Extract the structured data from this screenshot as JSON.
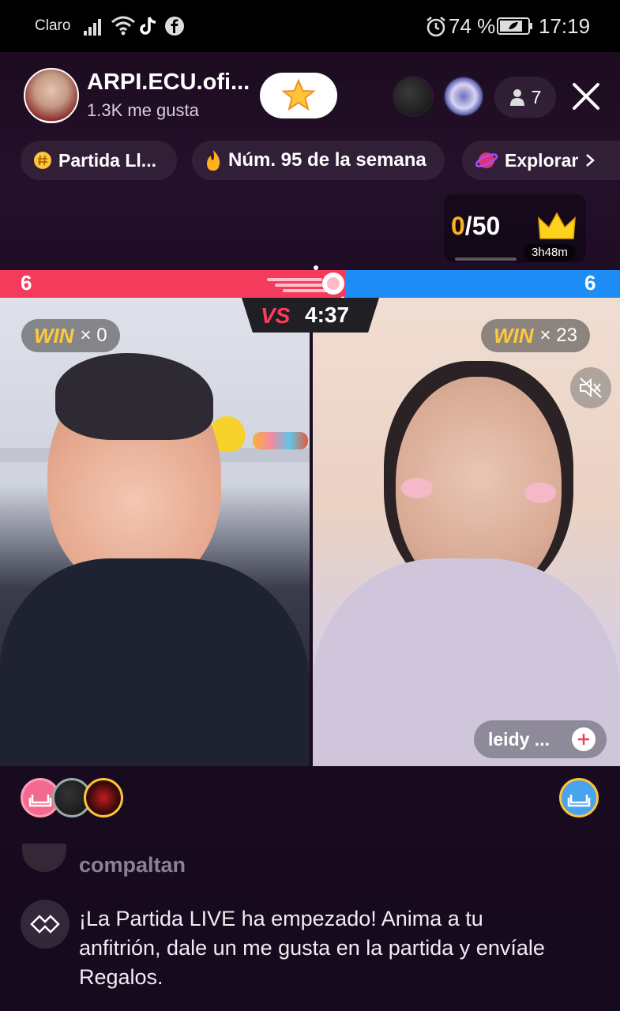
{
  "status_bar": {
    "carrier": "Claro",
    "battery": "74 %",
    "time": "17:19"
  },
  "header": {
    "host_name": "ARPI.ECU.ofi...",
    "likes": "1.3K me gusta",
    "viewer_count": "7"
  },
  "chips": {
    "partida": "Partida Ll...",
    "rank": "Núm. 95 de la semana",
    "explore": "Explorar"
  },
  "score": {
    "current": "0",
    "total": "/50",
    "countdown": "3h48m"
  },
  "battle": {
    "left_score": "6",
    "right_score": "6",
    "vs_label": "VS",
    "timer": "4:37",
    "left_win_label": "WIN",
    "left_win_count": "× 0",
    "right_win_label": "WIN",
    "right_win_count": "× 23",
    "opponent_name": "leidy ..."
  },
  "chat": {
    "partial_user": "compaltan",
    "system_message": "¡La Partida LIVE ha empezado! Anima a tu anfitrión, dale un me gusta en la partida y envíale Regalos."
  },
  "colors": {
    "red_team": "#f53b5c",
    "blue_team": "#1e8cf5",
    "win_yellow": "#ffc93c",
    "score_gold": "#ffb020"
  },
  "progress": {
    "left_share": 0.5
  }
}
